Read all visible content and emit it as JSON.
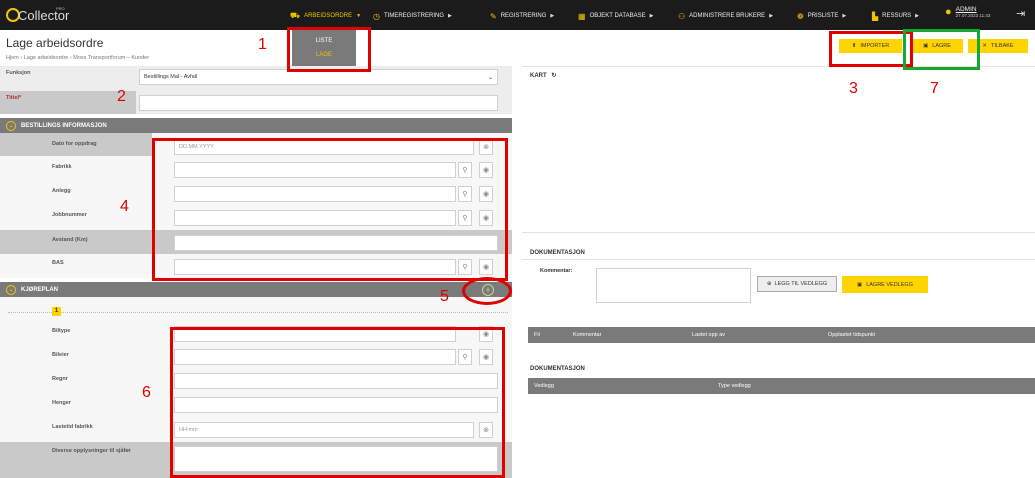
{
  "logo": {
    "text": "Collector",
    "pro": "PRO"
  },
  "nav": [
    {
      "label": "ARBEIDSORDRE",
      "icon": "truck-icon",
      "active": true
    },
    {
      "label": "TIMEREGISTRERING",
      "icon": "clock-icon"
    },
    {
      "label": "REGISTRERING",
      "icon": "edit-icon"
    },
    {
      "label": "OBJEKT DATABASE",
      "icon": "database-icon"
    },
    {
      "label": "ADMINISTRERE BRUKERE",
      "icon": "users-icon"
    },
    {
      "label": "PRISLISTE",
      "icon": "price-icon"
    },
    {
      "label": "RESSURS",
      "icon": "resource-icon"
    }
  ],
  "user": {
    "name": "ADMIN",
    "date": "27.07.2023 11:43"
  },
  "header": {
    "title": "Lage arbeidsordre",
    "breadcrumb": "Hjem › Lage arbeidsordre › Moss Transportforum – Kunder",
    "mode_list": "LISTE",
    "mode_create": "LAGE",
    "importer": "IMPORTER",
    "lagre": "LAGRE",
    "tilbake": "TILBAKE"
  },
  "form": {
    "funksjon_label": "Funksjon",
    "funksjon_value": "Bestillings Mal - Avfall",
    "tittel_label": "Tittel*",
    "section_order": "BESTILLINGS INFORMASJON",
    "fields": {
      "dato_label": "Dato for oppdrag",
      "dato_placeholder": "DD.MM.YYYY",
      "fabrikk_label": "Fabrikk",
      "anlegg_label": "Anlegg",
      "jobbnummer_label": "Jobbnummer",
      "avstand_label": "Avstand (Km)",
      "bas_label": "BAS"
    },
    "section_plan": "KJØREPLAN",
    "plan_index": "1",
    "plan_fields": {
      "biltype_label": "Biltype",
      "bileier_label": "Bileier",
      "regnr_label": "Regnr",
      "henger_label": "Henger",
      "lastetid_label": "Lastetid fabrikk",
      "lastetid_placeholder": "HH:mm",
      "diverse_label": "Diverse opplysninger til sjåfør"
    }
  },
  "right": {
    "kart_label": "KART",
    "dok_label": "DOKUMENTASJON",
    "kommentar_label": "Kommentar:",
    "legg_til": "LEGG TIL VEDLEGG",
    "lagre_vedlegg": "LAGRE VEDLEGG",
    "table1": {
      "fil": "Fil",
      "kommentar": "Kommentar",
      "lastet": "Lastet opp av",
      "opplastet": "Opplastet tidspunkt"
    },
    "dok2_label": "DOKUMENTASJON",
    "table2": {
      "vedlegg": "Vedlegg",
      "type": "Type vedlegg"
    }
  },
  "annotations": [
    "1",
    "2",
    "3",
    "4",
    "5",
    "6",
    "7"
  ],
  "colors": {
    "accent": "#ffd400",
    "annotation_red": "#e00000",
    "annotation_green": "#13a832",
    "section_gray": "#7a7a7a",
    "topbar": "#1b1b1b"
  }
}
